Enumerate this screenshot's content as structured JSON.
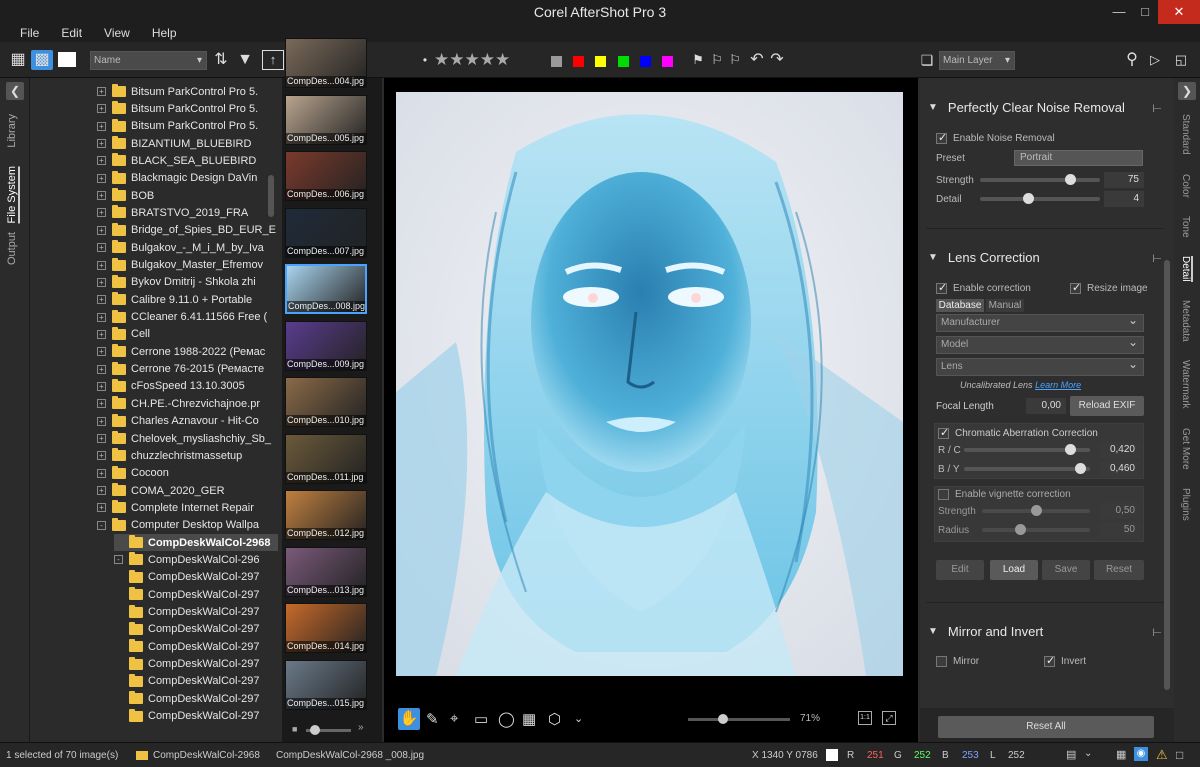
{
  "window": {
    "title": "Corel AfterShot Pro 3"
  },
  "menu": [
    "File",
    "Edit",
    "View",
    "Help"
  ],
  "toolbar": {
    "sort_field": "Name",
    "layer": "Main Layer",
    "stars": "★★★★★"
  },
  "colors": {
    "accent": "#4aa3ff",
    "folder": "#f0c243",
    "labels": [
      "#9a9a9a",
      "#ff0000",
      "#ffff00",
      "#00dd00",
      "#0000ff",
      "#ff00ff"
    ]
  },
  "left_tabs": [
    "Library",
    "File System",
    "Output"
  ],
  "tree": [
    {
      "label": "Bitsum ParkControl Pro 5.",
      "level": 1
    },
    {
      "label": "Bitsum ParkControl Pro 5.",
      "level": 1
    },
    {
      "label": "Bitsum ParkControl Pro 5.",
      "level": 1
    },
    {
      "label": "BIZANTIUM_BLUEBIRD",
      "level": 1
    },
    {
      "label": "BLACK_SEA_BLUEBIRD",
      "level": 1
    },
    {
      "label": "Blackmagic Design DaVin",
      "level": 1
    },
    {
      "label": "BOB",
      "level": 1
    },
    {
      "label": "BRATSTVO_2019_FRA",
      "level": 1
    },
    {
      "label": "Bridge_of_Spies_BD_EUR_E",
      "level": 1
    },
    {
      "label": "Bulgakov_-_M_i_M_by_Iva",
      "level": 1
    },
    {
      "label": "Bulgakov_Master_Efremov",
      "level": 1
    },
    {
      "label": "Bykov Dmitrij - Shkola zhi",
      "level": 1
    },
    {
      "label": "Calibre 9.11.0 + Portable",
      "level": 1
    },
    {
      "label": "CCleaner 6.41.11566 Free (",
      "level": 1
    },
    {
      "label": "Cell",
      "level": 1
    },
    {
      "label": "Cerrone 1988-2022 (Ремас",
      "level": 1
    },
    {
      "label": "Cerrone 76-2015 (Ремасте",
      "level": 1
    },
    {
      "label": "cFosSpeed 13.10.3005",
      "level": 1
    },
    {
      "label": "CH.PE.-Chrezvichajnoe.pr",
      "level": 1
    },
    {
      "label": "Charles Aznavour - Hit-Co",
      "level": 1
    },
    {
      "label": "Chelovek_mysliashchiy_Sb_",
      "level": 1
    },
    {
      "label": "chuzzlechristmassetup",
      "level": 1
    },
    {
      "label": "Cocoon",
      "level": 1
    },
    {
      "label": "COMA_2020_GER",
      "level": 1
    },
    {
      "label": "Complete Internet Repair ",
      "level": 1
    },
    {
      "label": "Computer Desktop Wallpa",
      "level": 1
    },
    {
      "label": "CompDeskWalCol-2968",
      "level": 2
    },
    {
      "label": "CompDeskWalCol-296",
      "level": 2
    },
    {
      "label": "CompDeskWalCol-297",
      "level": 2
    },
    {
      "label": "CompDeskWalCol-297",
      "level": 2
    },
    {
      "label": "CompDeskWalCol-297",
      "level": 2
    },
    {
      "label": "CompDeskWalCol-297",
      "level": 2
    },
    {
      "label": "CompDeskWalCol-297",
      "level": 2
    },
    {
      "label": "CompDeskWalCol-297",
      "level": 2
    },
    {
      "label": "CompDeskWalCol-297",
      "level": 2
    },
    {
      "label": "CompDeskWalCol-297",
      "level": 2
    },
    {
      "label": "CompDeskWalCol-297",
      "level": 2
    }
  ],
  "thumbs": [
    {
      "cap": "CompDes...004.jpg",
      "color": "#7a6a5a"
    },
    {
      "cap": "CompDes...005.jpg",
      "color": "#b8a48e"
    },
    {
      "cap": "CompDes...006.jpg",
      "color": "#7b3a2c"
    },
    {
      "cap": "CompDes...007.jpg",
      "color": "#1e2b3a"
    },
    {
      "cap": "CompDes...008.jpg",
      "color": "#a9d4ee"
    },
    {
      "cap": "CompDes...009.jpg",
      "color": "#5a3c8e"
    },
    {
      "cap": "CompDes...010.jpg",
      "color": "#8a6a48"
    },
    {
      "cap": "CompDes...011.jpg",
      "color": "#6b5a3a"
    },
    {
      "cap": "CompDes...012.jpg",
      "color": "#c08040"
    },
    {
      "cap": "CompDes...013.jpg",
      "color": "#7a5a7a"
    },
    {
      "cap": "CompDes...014.jpg",
      "color": "#c86a2a"
    },
    {
      "cap": "CompDes...015.jpg",
      "color": "#6a7a8a"
    }
  ],
  "viewer": {
    "zoom": "71%",
    "fit": "1:1"
  },
  "right_tabs": [
    "Standard",
    "Color",
    "Tone",
    "Detail",
    "Metadata",
    "Watermark",
    "Get More",
    "Plugins"
  ],
  "noise": {
    "title": "Perfectly Clear Noise Removal",
    "enable": "Enable Noise Removal",
    "preset_label": "Preset",
    "preset_value": "Portrait",
    "strength_label": "Strength",
    "strength_value": "75",
    "strength": 0.75,
    "detail_label": "Detail",
    "detail_value": "4",
    "detail": 0.4
  },
  "lens": {
    "title": "Lens Correction",
    "enable": "Enable correction",
    "resize": "Resize image",
    "tab_db": "Database",
    "tab_manual": "Manual",
    "manufacturer": "Manufacturer",
    "model": "Model",
    "lens": "Lens",
    "uncal": "Uncalibrated Lens",
    "learn": "Learn More",
    "focal_label": "Focal Length",
    "focal_value": "0,00",
    "reload": "Reload EXIF",
    "ca_label": "Chromatic Aberration Correction",
    "rc_label": "R / C",
    "rc_value": "0,420",
    "rc": 0.84,
    "by_label": "B / Y",
    "by_value": "0,460",
    "by": 0.92,
    "vig_label": "Enable vignette correction",
    "vs_label": "Strength",
    "vs_value": "0,50",
    "vs": 0.5,
    "vr_label": "Radius",
    "vr_value": "50",
    "vr": 0.35,
    "btn_edit": "Edit",
    "btn_load": "Load",
    "btn_save": "Save",
    "btn_reset": "Reset"
  },
  "mirror": {
    "title": "Mirror and Invert",
    "mirror": "Mirror",
    "invert": "Invert"
  },
  "reset_all": "Reset All",
  "status": {
    "selected": "1 selected of 70 image(s)",
    "folder": "CompDeskWalCol-2968",
    "file": "CompDeskWalCol-2968 _008.jpg",
    "coords": "X 1340  Y 0786",
    "r_label": "R",
    "r": "251",
    "g_label": "G",
    "g": "252",
    "b_label": "B",
    "b": "253",
    "l_label": "L",
    "l": "252"
  }
}
